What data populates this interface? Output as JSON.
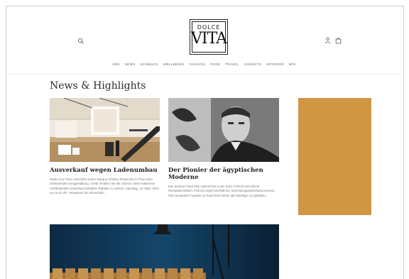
{
  "brand": {
    "logo_top": "DOLCE",
    "logo_bottom": "VITA"
  },
  "header": {
    "icons": [
      "search-icon",
      "account-icon",
      "cart-icon"
    ]
  },
  "nav": [
    {
      "label": "ABO"
    },
    {
      "label": "NEWS"
    },
    {
      "label": "SCHMUCK"
    },
    {
      "label": "WELLBEING"
    },
    {
      "label": "FASHION"
    },
    {
      "label": "FOOD"
    },
    {
      "label": "TRAVEL"
    },
    {
      "label": "GADGETS"
    },
    {
      "label": "INTERIOR"
    },
    {
      "label": "WIN"
    }
  ],
  "section": {
    "heading": "News & Highlights"
  },
  "articles": [
    {
      "title": "Ausverkauf wegen Ladenumbau",
      "excerpt": "Media Line Thun unterzieht seinen Bang & Olufsen Showroom in Thun einer umfassenden Neugestaltung. Vorab erhalten Sie die Chance, beim exklusiven Vorführgeräte-Ausverkauf attraktive Rabatte zu sichern. Samstag, 16. März 2024 von 9-14 Uhr. Verpassen Sie keinesfalls..."
    },
    {
      "title": "Der Pionier der ägyptischen Moderne",
      "excerpt": "Das Zentrum Paul Klee widmet ihm in der Serie FOKUS eine kleine Werkpräsentation. FOKUS zeigt innerhalb der Sammlungsausstellung Kosmos Klee besondere Aspekte zu Paul Klees Werk oder Beiträge zur globalen..."
    },
    {
      "title": "",
      "excerpt": ""
    }
  ],
  "colors": {
    "ad_block": "#cf9644",
    "page_bg": "#ffffff",
    "text": "#222222"
  }
}
